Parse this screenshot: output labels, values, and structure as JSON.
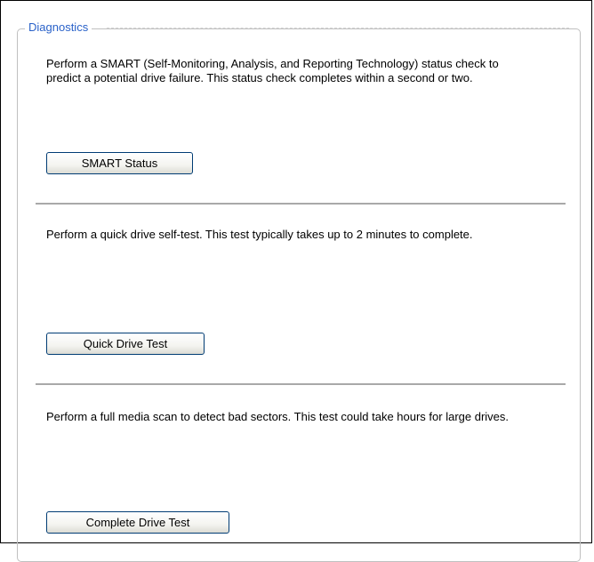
{
  "panel": {
    "legend": "Diagnostics"
  },
  "sections": [
    {
      "description": "Perform a SMART (Self-Monitoring, Analysis, and Reporting Technology) status check to predict a potential drive failure. This status check completes within a second or two.",
      "button_label": "SMART Status"
    },
    {
      "description": "Perform a quick drive self-test. This test typically takes up to 2 minutes to complete.",
      "button_label": "Quick Drive Test"
    },
    {
      "description": "Perform a full media scan to detect bad sectors. This test could take hours for large drives.",
      "button_label": "Complete Drive Test"
    }
  ],
  "colors": {
    "legend_text": "#2a62c9",
    "divider": "#a9a9a9",
    "button_border": "#003c74"
  }
}
